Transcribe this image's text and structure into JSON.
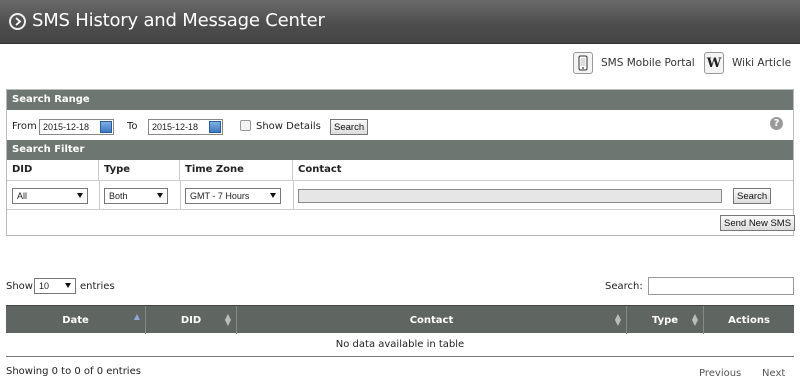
{
  "header": {
    "title": "SMS History and Message Center"
  },
  "top_links": {
    "portal": "SMS Mobile Portal",
    "wiki": "Wiki Article",
    "wiki_glyph": "W"
  },
  "search_range": {
    "heading": "Search Range",
    "from_label": "From",
    "from_value": "2015-12-18",
    "to_label": "To",
    "to_value": "2015-12-18",
    "show_details_label": "Show Details",
    "search_button": "Search",
    "help_glyph": "?"
  },
  "search_filter": {
    "heading": "Search Filter",
    "columns": {
      "did": "DID",
      "type": "Type",
      "timezone": "Time Zone",
      "contact": "Contact"
    },
    "did_value": "All",
    "type_value": "Both",
    "timezone_value": "GMT - 7 Hours",
    "search_button": "Search",
    "send_button": "Send New SMS"
  },
  "table_controls": {
    "show_label": "Show",
    "entries_value": "10",
    "entries_label": "entries",
    "search_label": "Search:"
  },
  "table": {
    "columns": [
      "Date",
      "DID",
      "Contact",
      "Type",
      "Actions"
    ],
    "empty_message": "No data available in table"
  },
  "footer": {
    "info": "Showing 0 to 0 of 0 entries",
    "previous": "Previous",
    "next": "Next"
  }
}
